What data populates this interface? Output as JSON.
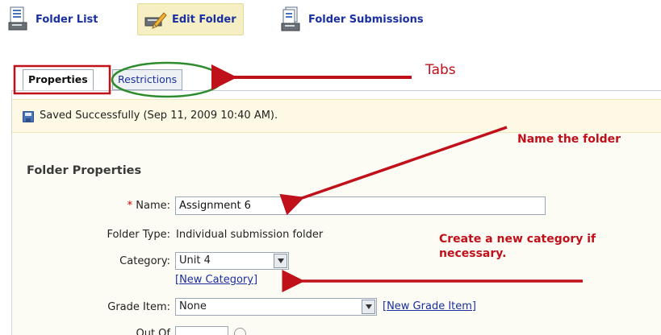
{
  "toolbar": {
    "folder_list_label": "Folder List",
    "edit_folder_label": "Edit Folder",
    "folder_submissions_label": "Folder Submissions"
  },
  "tabs": [
    {
      "label": "Properties",
      "active": true
    },
    {
      "label": "Restrictions",
      "active": false
    }
  ],
  "status": {
    "saved_message": "Saved Successfully (Sep 11, 2009 10:40 AM)."
  },
  "section": {
    "title": "Folder Properties"
  },
  "form": {
    "name_label": "Name:",
    "name_required_marker": "*",
    "name_value": "Assignment 6",
    "folder_type_label": "Folder Type:",
    "folder_type_value": "Individual submission folder",
    "category_label": "Category:",
    "category_value": "Unit 4",
    "new_category_link": "[New Category]",
    "grade_item_label": "Grade Item:",
    "grade_item_value": "None",
    "new_grade_item_link": "[New Grade Item]",
    "out_of_label": "Out Of"
  },
  "annotations": {
    "tabs": "Tabs",
    "name_the_folder": "Name the folder",
    "create_category_line1": "Create a new category if",
    "create_category_line2": "necessary."
  },
  "colors": {
    "link": "#1a2fa0",
    "annotation_red": "#c0101a",
    "annotation_green": "#2e8b2e",
    "saved_bar": "#fdf9e4"
  }
}
